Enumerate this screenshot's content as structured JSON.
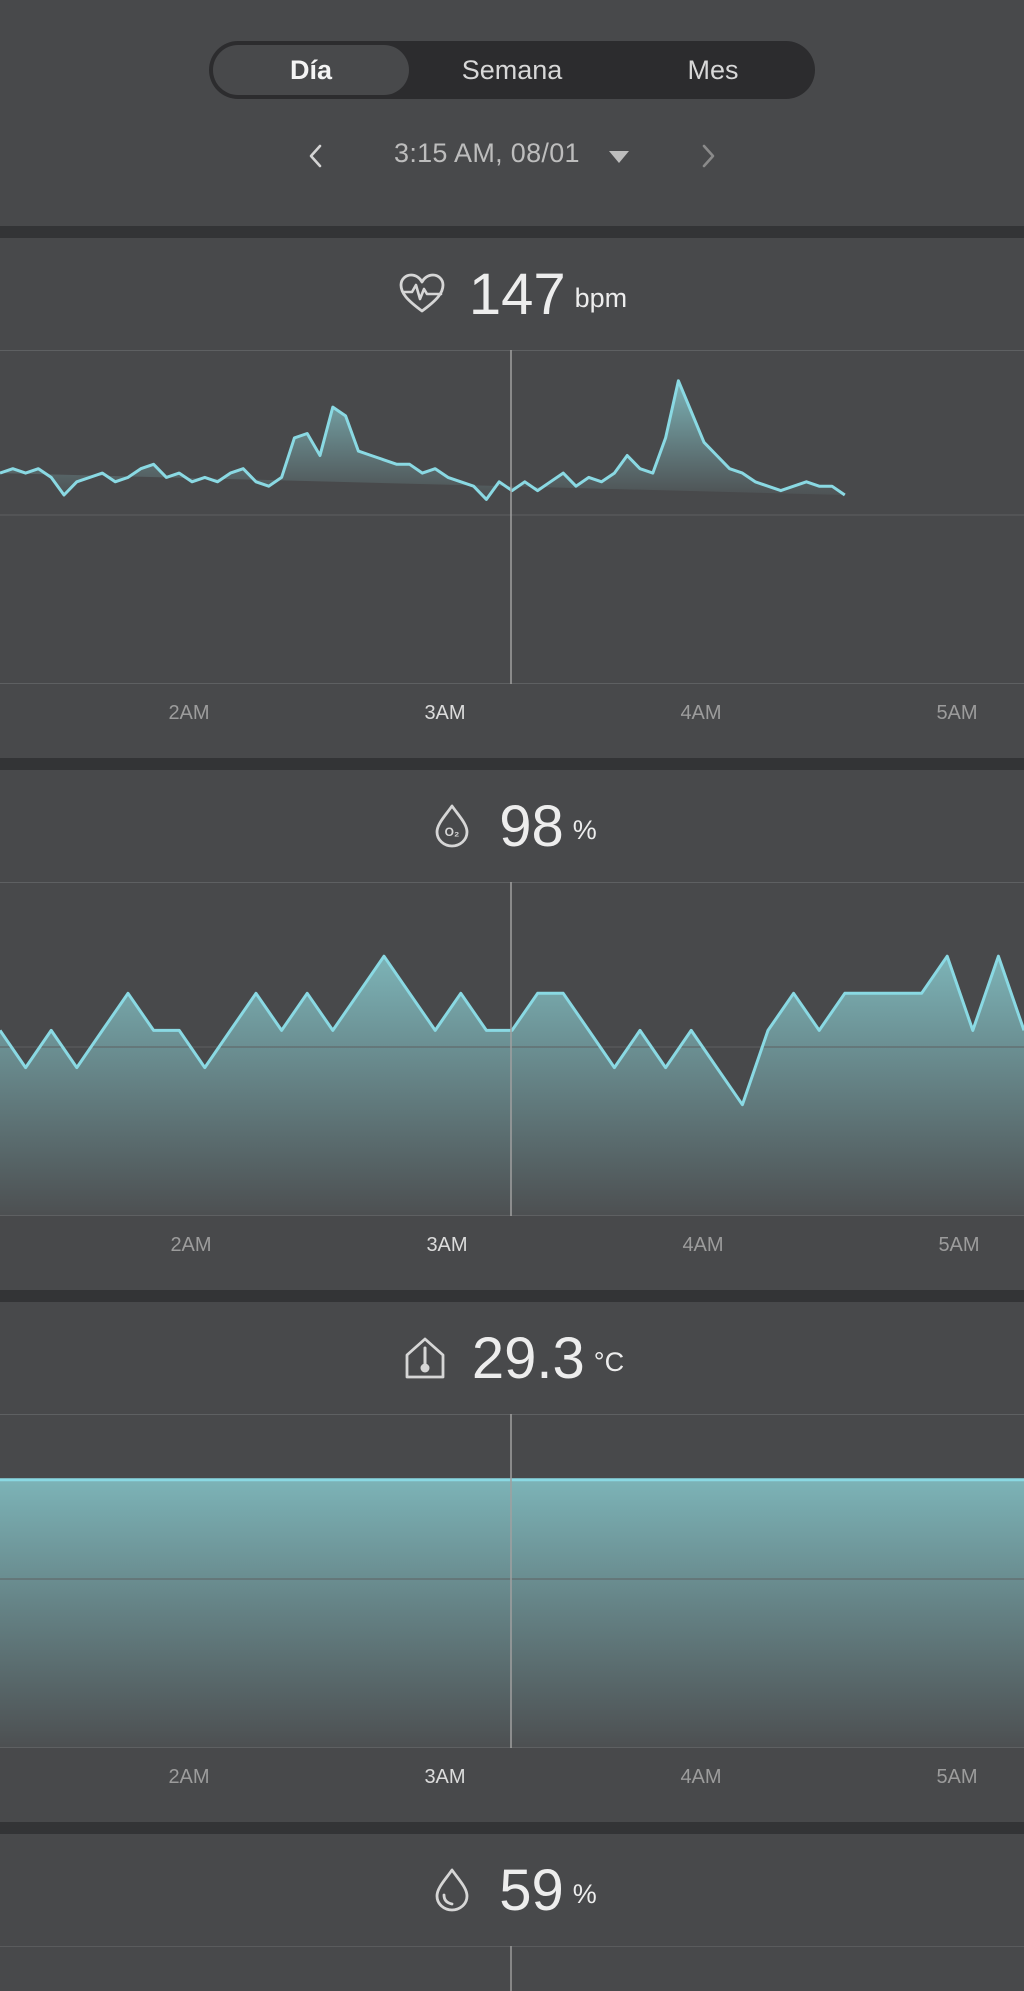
{
  "tabs": [
    {
      "label": "Día",
      "active": true
    },
    {
      "label": "Semana",
      "active": false
    },
    {
      "label": "Mes",
      "active": false
    }
  ],
  "date_nav": {
    "label": "3:15 AM, 08/01"
  },
  "colors": {
    "accent": "#8ad9e3",
    "fill_top": "#7fb9bd",
    "fill_bottom": "#4d5052",
    "bg": "#48494b"
  },
  "panels": [
    {
      "id": "heart_rate",
      "icon": "heart-rate-icon",
      "value": "147",
      "unit": "bpm"
    },
    {
      "id": "spo2",
      "icon": "oxygen-drop-icon",
      "value": "98",
      "unit": "%"
    },
    {
      "id": "temperature",
      "icon": "house-thermometer-icon",
      "value": "29.3",
      "unit": "°C"
    },
    {
      "id": "humidity",
      "icon": "humidity-drop-icon",
      "value": "59",
      "unit": "%"
    }
  ],
  "time_ticks": [
    "2AM",
    "3AM",
    "4AM",
    "5AM"
  ],
  "chart_data": [
    {
      "type": "area",
      "x_ticks": [
        "2AM",
        "3AM",
        "4AM",
        "5AM"
      ],
      "x_range": [
        "1:15 AM",
        "5:15 AM"
      ],
      "current_time": "3:15 AM",
      "grid": true,
      "series": [
        {
          "t": [
            0.0,
            0.05,
            0.1,
            0.15,
            0.2,
            0.25,
            0.3,
            0.35,
            0.4,
            0.45,
            0.5,
            0.55,
            0.6,
            0.65,
            0.7,
            0.75,
            0.8,
            0.85,
            0.9,
            0.95,
            1.0,
            1.05,
            1.1,
            1.15,
            1.2,
            1.25,
            1.3,
            1.35,
            1.4,
            1.45,
            1.5,
            1.55,
            1.6,
            1.65,
            1.7,
            1.75,
            1.8,
            1.85,
            1.9,
            1.95,
            2.0,
            2.05,
            2.1,
            2.15,
            2.2,
            2.25,
            2.3,
            2.35,
            2.4,
            2.45,
            2.5,
            2.55,
            2.6,
            2.65,
            2.7,
            2.75,
            2.8,
            2.85,
            2.9,
            2.95,
            3.0,
            3.05,
            3.1,
            3.15,
            3.2,
            3.25,
            3.3,
            3.35,
            3.4,
            3.45,
            3.5,
            3.55,
            3.6,
            3.65,
            3.7,
            3.75,
            3.8,
            3.85,
            3.9,
            3.95,
            4.0
          ],
          "y": [
            148,
            149,
            148,
            149,
            147,
            143,
            146,
            147,
            148,
            146,
            147,
            149,
            150,
            147,
            148,
            146,
            147,
            146,
            148,
            149,
            146,
            145,
            147,
            156,
            157,
            152,
            163,
            161,
            153,
            152,
            151,
            150,
            150,
            148,
            149,
            147,
            146,
            145,
            142,
            146,
            144,
            146,
            144,
            146,
            148,
            145,
            147,
            146,
            148,
            152,
            149,
            148,
            156,
            169,
            162,
            155,
            152,
            149,
            148,
            146,
            145,
            144,
            145,
            146,
            145,
            145,
            143
          ]
        }
      ]
    },
    {
      "type": "area",
      "x_ticks": [
        "2AM",
        "3AM",
        "4AM",
        "5AM"
      ],
      "current_time": "3:15 AM",
      "grid": true,
      "series": [
        {
          "t": [
            0.0,
            0.1,
            0.2,
            0.3,
            0.4,
            0.5,
            0.6,
            0.7,
            0.8,
            0.9,
            1.0,
            1.1,
            1.2,
            1.3,
            1.4,
            1.5,
            1.6,
            1.7,
            1.8,
            1.9,
            2.0,
            2.1,
            2.2,
            2.3,
            2.4,
            2.5,
            2.6,
            2.7,
            2.8,
            2.9,
            3.0,
            3.1,
            3.2,
            3.3,
            3.4,
            3.5,
            3.6,
            3.7,
            3.8,
            3.9,
            4.0
          ],
          "y": [
            98,
            97,
            98,
            97,
            98,
            99,
            98,
            98,
            97,
            98,
            99,
            98,
            99,
            98,
            99,
            100,
            99,
            98,
            99,
            98,
            98,
            99,
            99,
            98,
            97,
            98,
            97,
            98,
            97,
            96,
            98,
            99,
            98,
            99,
            99,
            99,
            99,
            100,
            98,
            100,
            98
          ]
        }
      ]
    },
    {
      "type": "area",
      "x_ticks": [
        "2AM",
        "3AM",
        "4AM",
        "5AM"
      ],
      "current_time": "3:15 AM",
      "grid": true,
      "series": [
        {
          "t": [
            0.0,
            1.0,
            2.0,
            3.0,
            4.0
          ],
          "y": [
            29.3,
            29.3,
            29.3,
            29.3,
            29.3
          ]
        }
      ]
    }
  ]
}
